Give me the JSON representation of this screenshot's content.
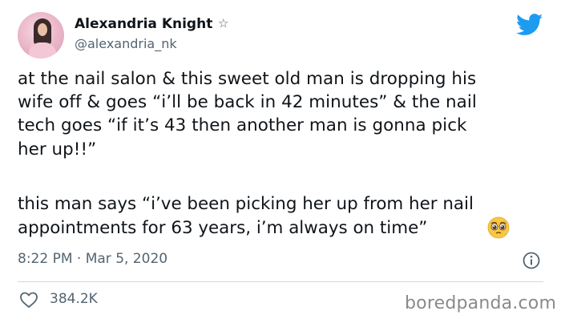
{
  "author": {
    "name": "Alexandria Knight",
    "badge": "☆",
    "handle": "@alexandria_nk"
  },
  "tweet": {
    "paragraph1": [
      "at the nail salon & this sweet old man is dropping his",
      "wife off & goes “i’ll be back in 42 minutes” & the nail",
      "tech goes “if it’s 43 then another man is gonna pick",
      "her up!!”"
    ],
    "paragraph2": [
      "this man says “i’ve been picking her up from her nail",
      "appointments for 63 years, i’m always on time”"
    ],
    "emoji": "pleading-face-emoji",
    "timestamp": "8:22 PM · Mar 5, 2020",
    "likes": "384.2K"
  },
  "icons": {
    "platform": "twitter-bird-icon",
    "info": "info-icon",
    "like": "heart-icon"
  },
  "colors": {
    "twitter_blue": "#1d9bf0",
    "text_primary": "#0f1419",
    "text_secondary": "#536471",
    "divider": "#cfd9de"
  },
  "watermark": "boredpanda.com"
}
